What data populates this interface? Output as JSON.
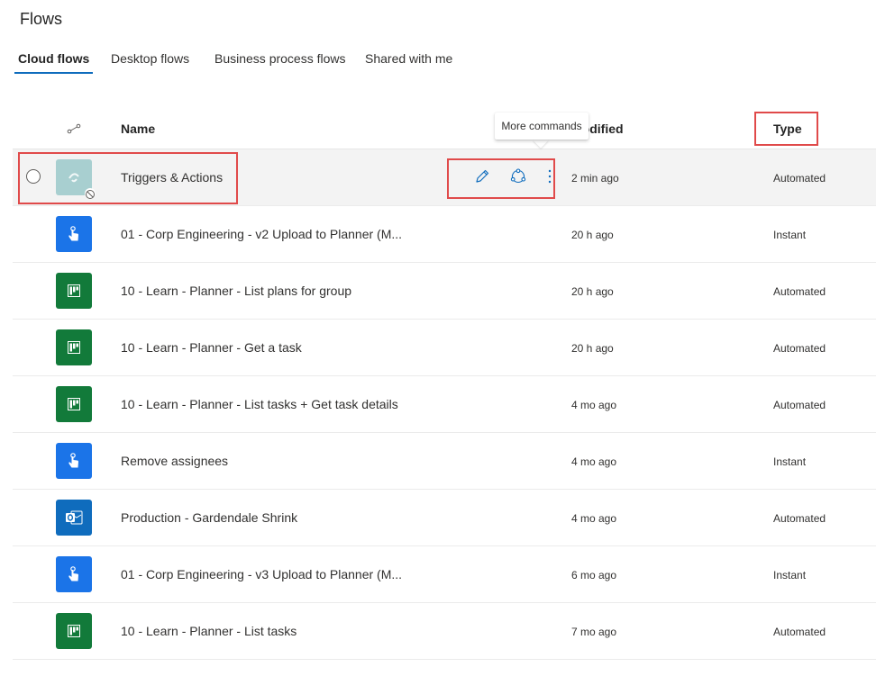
{
  "page": {
    "title": "Flows"
  },
  "tabs": [
    {
      "label": "Cloud flows",
      "active": true
    },
    {
      "label": "Desktop flows",
      "active": false
    },
    {
      "label": "Business process flows",
      "active": false
    },
    {
      "label": "Shared with me",
      "active": false
    }
  ],
  "table": {
    "columns": {
      "icon": "flow-type-icon",
      "name": "Name",
      "modified": "Modified",
      "type": "Type"
    },
    "rows": [
      {
        "name": "Triggers & Actions",
        "modified": "2 min ago",
        "type": "Automated",
        "icon": "disabled-flow-icon",
        "selected": true,
        "disabled": true
      },
      {
        "name": "01 - Corp Engineering - v2 Upload to Planner (M...",
        "modified": "20 h ago",
        "type": "Instant",
        "icon": "button-touch-icon"
      },
      {
        "name": "10 - Learn - Planner - List plans for group",
        "modified": "20 h ago",
        "type": "Automated",
        "icon": "planner-icon"
      },
      {
        "name": "10 - Learn - Planner - Get a task",
        "modified": "20 h ago",
        "type": "Automated",
        "icon": "planner-icon"
      },
      {
        "name": "10 - Learn - Planner - List tasks + Get task details",
        "modified": "4 mo ago",
        "type": "Automated",
        "icon": "planner-icon"
      },
      {
        "name": "Remove assignees",
        "modified": "4 mo ago",
        "type": "Instant",
        "icon": "button-touch-icon"
      },
      {
        "name": "Production - Gardendale Shrink",
        "modified": "4 mo ago",
        "type": "Automated",
        "icon": "outlook-icon"
      },
      {
        "name": "01 - Corp Engineering - v3 Upload to Planner (M...",
        "modified": "6 mo ago",
        "type": "Instant",
        "icon": "button-touch-icon"
      },
      {
        "name": "10 - Learn - Planner - List tasks",
        "modified": "7 mo ago",
        "type": "Automated",
        "icon": "planner-icon"
      }
    ]
  },
  "row_actions": {
    "edit_icon": "pencil-icon",
    "share_icon": "share-icon",
    "more_icon": "more-commands-icon"
  },
  "tooltip": {
    "text": "More commands"
  },
  "colors": {
    "accent": "#0f6cbd",
    "highlight": "#e04a4a",
    "button_flow": "#1b74e8",
    "planner": "#127a3a",
    "outlook": "#0f6cbd"
  }
}
